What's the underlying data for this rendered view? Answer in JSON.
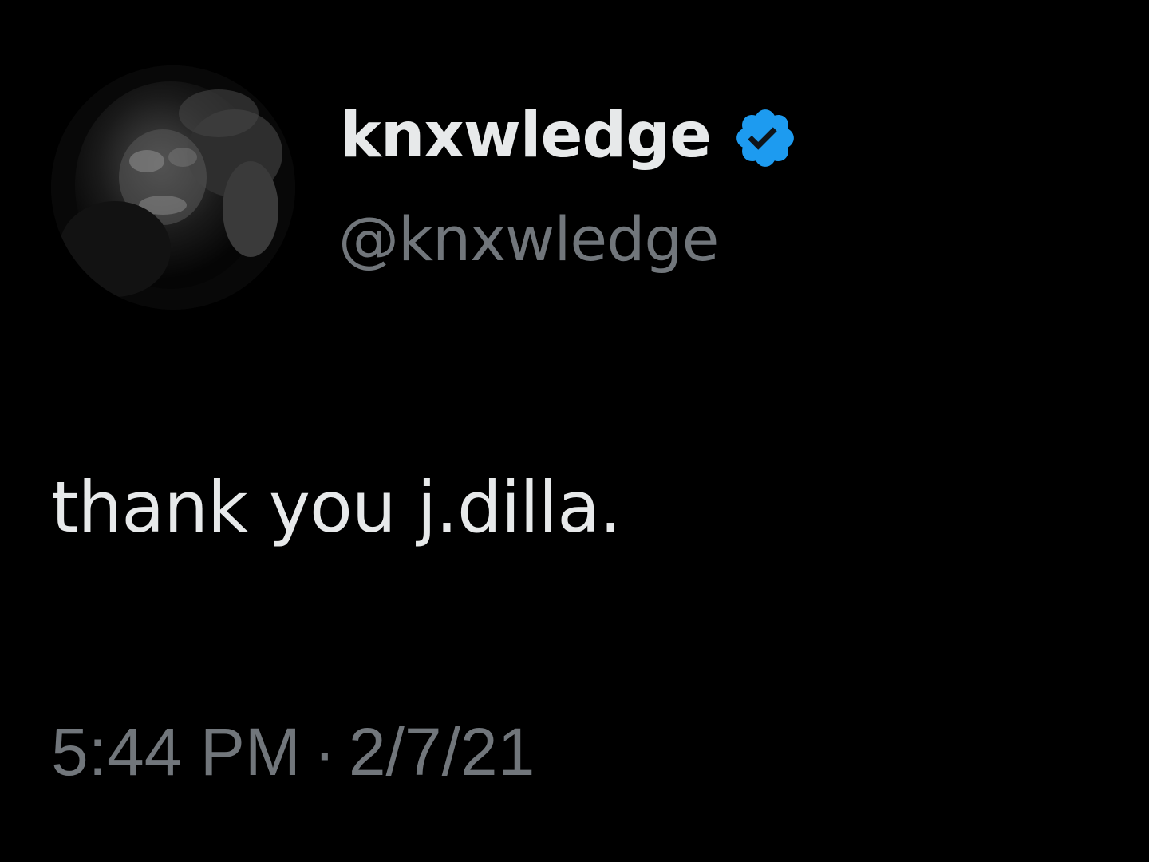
{
  "tweet": {
    "author": {
      "display_name": "knxwledge",
      "handle": "@knxwledge",
      "verified": true,
      "verified_icon": "verified-badge-icon",
      "verified_color": "#1d9bf0",
      "avatar": "profile-avatar"
    },
    "text": "thank you j.dilla.",
    "time": "5:44 PM",
    "separator": "·",
    "date": "2/7/21"
  },
  "colors": {
    "background": "#000000",
    "primary_text": "#e7e9ea",
    "secondary_text": "#71767b"
  }
}
